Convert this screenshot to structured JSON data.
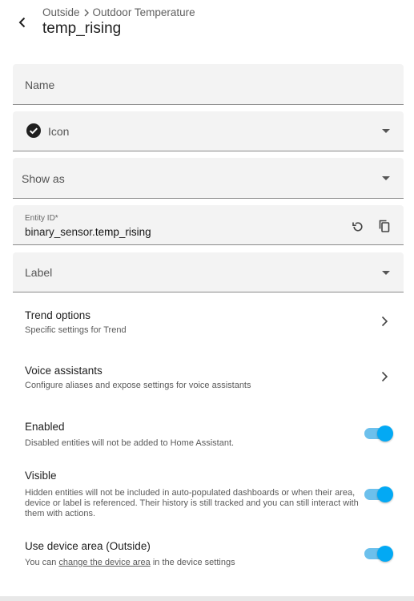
{
  "header": {
    "breadcrumb": [
      "Outside",
      "Outdoor Temperature"
    ],
    "title": "temp_rising"
  },
  "form": {
    "name_placeholder": "Name",
    "icon_label": "Icon",
    "icon_name": "check-circle-icon",
    "show_as_placeholder": "Show as",
    "entity_id_label": "Entity ID*",
    "entity_id_prefix": "binary_sensor.",
    "entity_id_suffix": "temp_rising",
    "label_placeholder": "Label"
  },
  "nav_rows": [
    {
      "title": "Trend options",
      "subtitle": "Specific settings for Trend"
    },
    {
      "title": "Voice assistants",
      "subtitle": "Configure aliases and expose settings for voice assistants"
    }
  ],
  "toggles": {
    "enabled": {
      "title": "Enabled",
      "subtitle": "Disabled entities will not be added to Home Assistant.",
      "on": true
    },
    "visible": {
      "title": "Visible",
      "subtitle": "Hidden entities will not be included in auto-populated dashboards or when their area, device or label is referenced. Their history is still tracked and you can still interact with them with actions.",
      "on": true
    },
    "device_area": {
      "title": "Use device area (Outside)",
      "subtitle_prefix": "You can ",
      "subtitle_link": "change the device area",
      "subtitle_suffix": " in the device settings",
      "on": true
    }
  },
  "colors": {
    "accent": "#03a9f4",
    "track": "#6cc0ec",
    "field_bg": "#f3f3f3"
  }
}
